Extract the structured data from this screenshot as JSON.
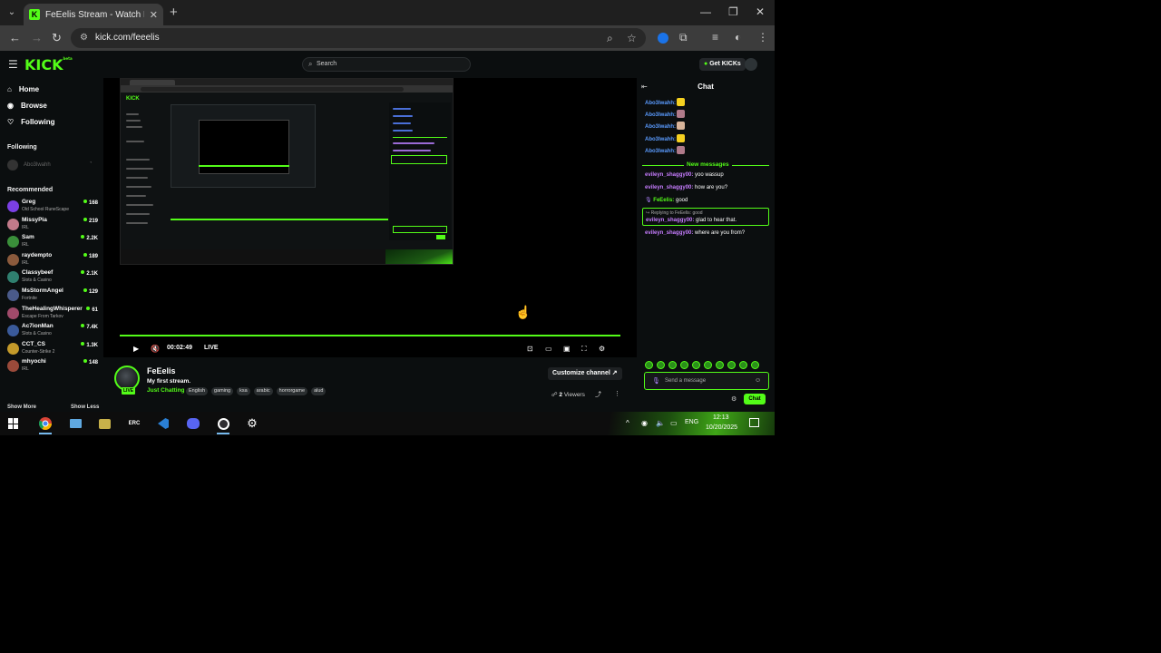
{
  "browser": {
    "tab_title": "FeEelis Stream - Watch Live on Kick",
    "favicon_letter": "K",
    "url": "kick.com/feeelis",
    "new_tab": "+",
    "close": "✕"
  },
  "kick": {
    "logo": "KICK",
    "logo_badge": "beta",
    "search_placeholder": "Search",
    "get_kicks": "Get KICKs"
  },
  "sidebar": {
    "nav": [
      {
        "label": "Home",
        "icon": "home-icon"
      },
      {
        "label": "Browse",
        "icon": "compass-icon"
      },
      {
        "label": "Following",
        "icon": "heart-icon"
      }
    ],
    "following_title": "Following",
    "following_user": "Abo3lwahh",
    "recommended_title": "Recommended",
    "recommended": [
      {
        "name": "Greg",
        "category": "Old School RuneScape",
        "viewers": "168",
        "color": "#7b3fe4"
      },
      {
        "name": "MissyPia",
        "category": "IRL",
        "viewers": "219",
        "color": "#c27a8a"
      },
      {
        "name": "Sam",
        "category": "IRL",
        "viewers": "2.2K",
        "color": "#3a8f3a"
      },
      {
        "name": "raydempto",
        "category": "IRL",
        "viewers": "189",
        "color": "#8b5a3c"
      },
      {
        "name": "Classybeef",
        "category": "Slots & Casino",
        "viewers": "2.1K",
        "color": "#2f7f6f"
      },
      {
        "name": "MsStormAngel",
        "category": "Fortnite",
        "viewers": "129",
        "color": "#4a5a8a"
      },
      {
        "name": "TheHealingWhisperer",
        "category": "Escape From Tarkov",
        "viewers": "61",
        "color": "#a04a6a"
      },
      {
        "name": "Ac7ionMan",
        "category": "Slots & Casino",
        "viewers": "7.4K",
        "color": "#3a5a9a"
      },
      {
        "name": "CCT_CS",
        "category": "Counter-Strike 2",
        "viewers": "1.3K",
        "color": "#c49a2a"
      },
      {
        "name": "mhyochi",
        "category": "IRL",
        "viewers": "148",
        "color": "#9a4a3a"
      }
    ],
    "show_more": "Show More",
    "show_less": "Show Less"
  },
  "player": {
    "time": "00:02:49",
    "live": "LIVE",
    "progress": 1.0
  },
  "stream": {
    "streamer": "FeEelis",
    "live_badge": "LIVE",
    "title": "My first stream.",
    "category": "Just Chatting",
    "tags": [
      "English",
      "gaming",
      "ksa",
      "arabic",
      "horrorgame",
      "alud"
    ],
    "customize": "Customize channel",
    "viewer_count": "2",
    "viewers_label": "Viewers"
  },
  "chat": {
    "title": "Chat",
    "early_messages": [
      {
        "user": "Abo3lwahh:",
        "emote_color": "#f5d020"
      },
      {
        "user": "Abo3lwahh:",
        "emote_color": "#b07a8a"
      },
      {
        "user": "Abo3lwahh:",
        "emote_color": "#d8b49a"
      },
      {
        "user": "Abo3lwahh:",
        "emote_color": "#f5d020"
      },
      {
        "user": "Abo3lwahh:",
        "emote_color": "#b07a8a"
      }
    ],
    "new_messages_label": "New messages",
    "messages": [
      {
        "user": "evileyn_shaggy00:",
        "text": "yoo wassup"
      },
      {
        "user": "evileyn_shaggy00:",
        "text": "how are you?"
      },
      {
        "user": "FeEelis:",
        "text": "good"
      }
    ],
    "reply_head": "Replying to FeEelis: good",
    "reply_user": "evileyn_shaggy00:",
    "reply_text": "glad to hear that.",
    "last_user": "evileyn_shaggy00:",
    "last_text": "where are you from?",
    "input_placeholder": "Send a message",
    "send": "Chat"
  },
  "taskbar": {
    "time": "12:13",
    "date": "10/20/2025",
    "lang": "ENG"
  },
  "colors": {
    "kick_green": "#53fc18",
    "username_blue": "#5a9bff",
    "username_purple": "#c77dff"
  }
}
